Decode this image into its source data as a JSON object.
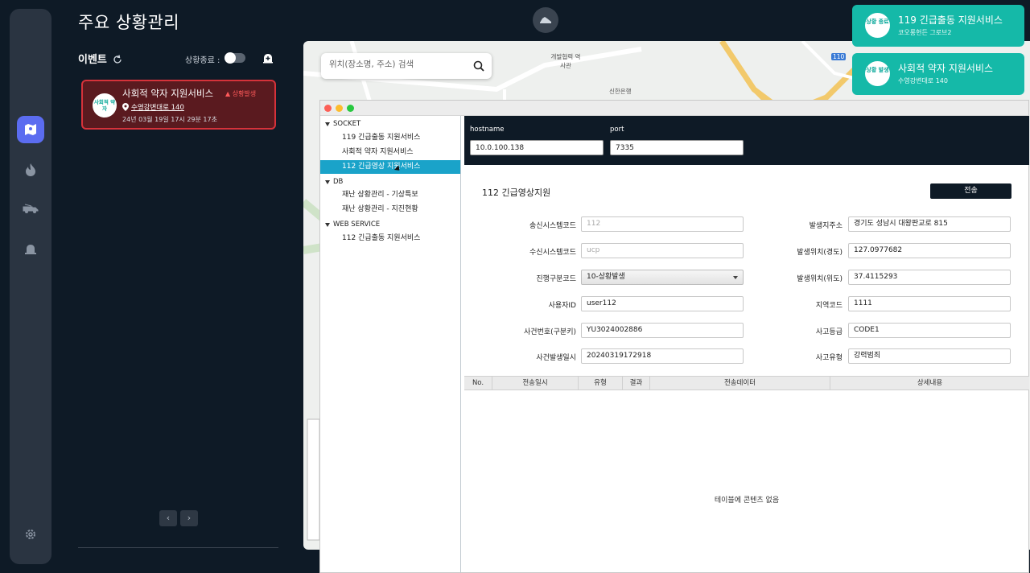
{
  "header": {
    "title": "주요 상황관리"
  },
  "events": {
    "title": "이벤트",
    "end_label": "상황종료 :",
    "items": [
      {
        "avatar": "사회적 약자",
        "title": "사회적 약자 지원서비스",
        "badge": "상황발생",
        "location": "수영강변대로 140",
        "time": "24년 03월 19일 17시 29분 17초"
      }
    ],
    "prev": "‹",
    "next": "›"
  },
  "map": {
    "search_placeholder": "위치(장소명, 주소) 검색",
    "labels": [
      "개발협력 역사관",
      "신한은행",
      "110"
    ]
  },
  "toasts": [
    {
      "avatar": "상황 종료",
      "title": "119 긴급출동 지원서비스",
      "subtitle": "코오롱헌든 그로브2"
    },
    {
      "avatar": "상황 발생",
      "title": "사회적 약자 지원서비스",
      "subtitle": "수영강변대로 140"
    }
  ],
  "tree": {
    "groups": [
      {
        "label": "SOCKET",
        "items": [
          "119 긴급출동 지원서비스",
          "사회적 약자 지원서비스",
          "112 긴급영상 지원서비스"
        ]
      },
      {
        "label": "DB",
        "items": [
          "재난 상황관리 - 기상특보",
          "재난 상황관리 - 지진현황"
        ]
      },
      {
        "label": "WEB SERVICE",
        "items": [
          "112 긴급출동 지원서비스"
        ]
      }
    ]
  },
  "conn": {
    "hostname_label": "hostname",
    "hostname_value": "10.0.100.138",
    "port_label": "port",
    "port_value": "7335"
  },
  "form": {
    "title": "112 긴급영상지원",
    "send": "전송",
    "left": [
      {
        "label": "송신시스템코드",
        "value": "112",
        "placeholder": true
      },
      {
        "label": "수신시스템코드",
        "value": "ucp",
        "placeholder": true
      },
      {
        "label": "진행구분코드",
        "value": "10-상황발생",
        "select": true
      },
      {
        "label": "사용자ID",
        "value": "user112"
      },
      {
        "label": "사건번호(구분키)",
        "value": "YU3024002886"
      },
      {
        "label": "사건발생일시",
        "value": "20240319172918"
      }
    ],
    "right": [
      {
        "label": "발생지주소",
        "value": "경기도 성남시 대왕판교로 815"
      },
      {
        "label": "발생위치(경도)",
        "value": "127.0977682"
      },
      {
        "label": "발생위치(위도)",
        "value": "37.4115293"
      },
      {
        "label": "지역코드",
        "value": "1111"
      },
      {
        "label": "사고등급",
        "value": "CODE1"
      },
      {
        "label": "사고유형",
        "value": "강력범죄"
      }
    ]
  },
  "table": {
    "columns": [
      "No.",
      "전송일시",
      "유형",
      "결과",
      "전송데이터",
      "상세내용"
    ],
    "empty": "테이블에 콘텐츠 없음"
  }
}
